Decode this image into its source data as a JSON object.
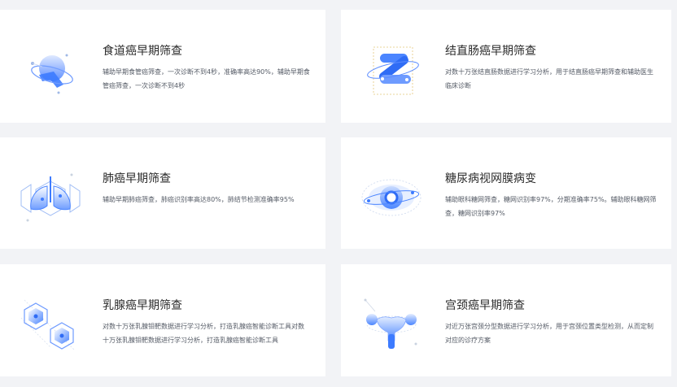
{
  "colors": {
    "accent": "#3d7bff",
    "accent_light": "#a9c6ff",
    "page_bg": "#f2f3f6",
    "card_bg": "#ffffff"
  },
  "cards": [
    {
      "title": "食道癌早期筛查",
      "desc": "辅助早期食管癌筛查，一次诊断不到4秒，准确率高达90%，辅助早期食管癌筛查，一次诊断不到4秒",
      "icon": "esophagus-icon"
    },
    {
      "title": "结直肠癌早期筛查",
      "desc": "对数十万张结直肠数据进行学习分析，用于结直肠癌早期筛查和辅助医生临床诊断",
      "icon": "colon-icon"
    },
    {
      "title": "肺癌早期筛查",
      "desc": "辅助早期肺癌筛查，肺癌识别率高达80%，肺结节检测准确率95%",
      "icon": "lung-icon"
    },
    {
      "title": "糖尿病视网膜病变",
      "desc": "辅助眼科糖网筛查，糖网识别率97%，分期准确率75%。辅助眼科糖网筛查，糖网识别率97%",
      "icon": "eye-icon"
    },
    {
      "title": "乳腺癌早期筛查",
      "desc": "对数十万张乳腺钼靶数据进行学习分析，打造乳腺癌智能诊断工具对数十万张乳腺钼靶数据进行学习分析，打造乳腺癌智能诊断工具",
      "icon": "breast-hexagon-icon"
    },
    {
      "title": "宫颈癌早期筛查",
      "desc": "对近万张宫颈分型数据进行学习分析，用于宫颈位置类型检测，从而定制对应的诊疗方案",
      "icon": "uterus-icon"
    }
  ]
}
